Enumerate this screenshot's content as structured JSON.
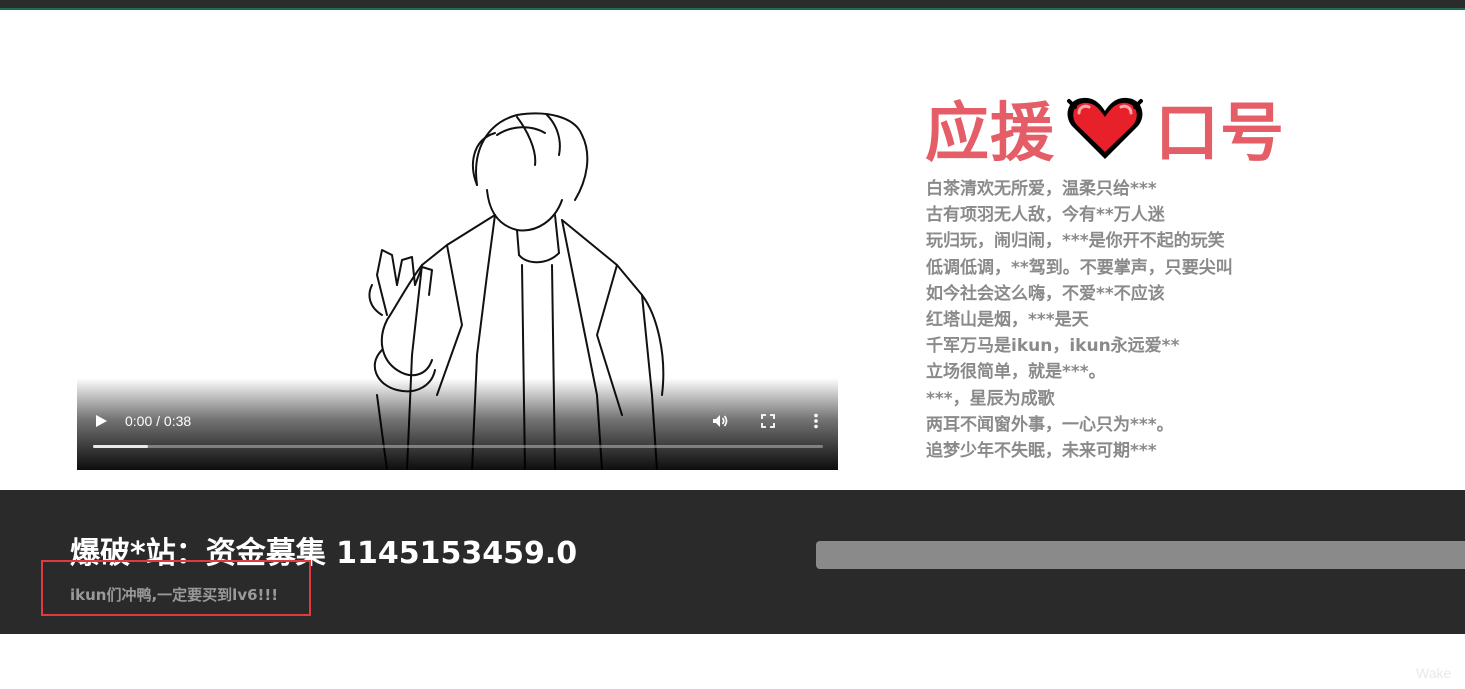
{
  "video": {
    "time": "0:00 / 0:38",
    "progress": 0.075,
    "play_icon": "play-icon",
    "volume_icon": "volume-icon",
    "fullscreen_icon": "fullscreen-icon",
    "more_icon": "more-vert-icon"
  },
  "cheer": {
    "title_left": "应援",
    "title_right": "口号",
    "heart_icon": "heart-icon",
    "accent_color": "#e55e67",
    "slogans": [
      "白茶清欢无所爱，温柔只给***",
      "古有项羽无人敌，今有**万人迷",
      "玩归玩，闹归闹，***是你开不起的玩笑",
      "低调低调，**驾到。不要掌声，只要尖叫",
      "如今社会这么嗨，不爱**不应该",
      "红塔山是烟，***是天",
      "千军万马是ikun，ikun永远爱**",
      "立场很简单，就是***。",
      "***，星辰为成歌",
      "两耳不闻窗外事，一心只为***。",
      "追梦少年不失眠，未来可期***"
    ]
  },
  "funding": {
    "title": "爆破*站：资金募集 1145153459.0",
    "subtitle": "ikun们冲鸭,一定要买到lv6!!!"
  },
  "watermark": "Wake"
}
